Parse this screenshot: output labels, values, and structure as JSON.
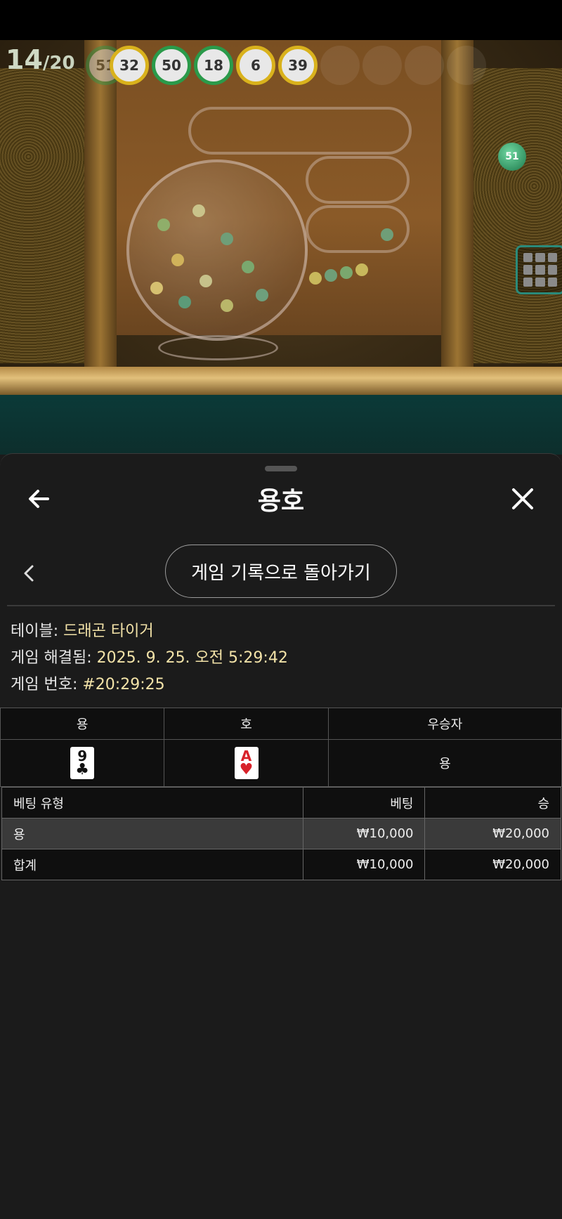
{
  "stream": {
    "draw_counter": {
      "current": "14",
      "total": "/20"
    },
    "drawn_balls": [
      {
        "number": "51",
        "color": "green",
        "faded": true
      },
      {
        "number": "32",
        "color": "yellow"
      },
      {
        "number": "50",
        "color": "green"
      },
      {
        "number": "18",
        "color": "green"
      },
      {
        "number": "6",
        "color": "yellow"
      },
      {
        "number": "39",
        "color": "yellow"
      }
    ],
    "flying_ball": "51",
    "grid_button_icon": "grid-icon"
  },
  "sheet": {
    "title": "용호",
    "back_icon": "arrow-left-icon",
    "close_icon": "close-icon",
    "chevron_icon": "chevron-left-icon",
    "return_button": "게임 기록으로 돌아가기",
    "info": {
      "table_label": "테이블: ",
      "table_value": "드래곤 타이거",
      "resolved_label": "게임 해결됨: ",
      "resolved_value": "2025. 9. 25. 오전 5:29:42",
      "round_label": "게임 번호: ",
      "round_value": "#20:29:25"
    },
    "cards_table": {
      "headers": [
        "용",
        "호",
        "우승자"
      ],
      "dragon_card": {
        "rank": "9",
        "suit": "♣",
        "color": "black"
      },
      "tiger_card": {
        "rank": "A",
        "suit": "♥",
        "color": "red"
      },
      "winner": "용"
    },
    "bets_table": {
      "headers": [
        "베팅 유형",
        "베팅",
        "승"
      ],
      "rows": [
        {
          "type": "용",
          "bet": "₩10,000",
          "win": "₩20,000"
        },
        {
          "type": "합계",
          "bet": "₩10,000",
          "win": "₩20,000"
        }
      ]
    }
  },
  "colors": {
    "sheet_bg": "#1b1b1b",
    "info_value": "#f3e3a8",
    "table_dark": "#0f0f0f",
    "row_highlight": "#3a3a3a"
  }
}
